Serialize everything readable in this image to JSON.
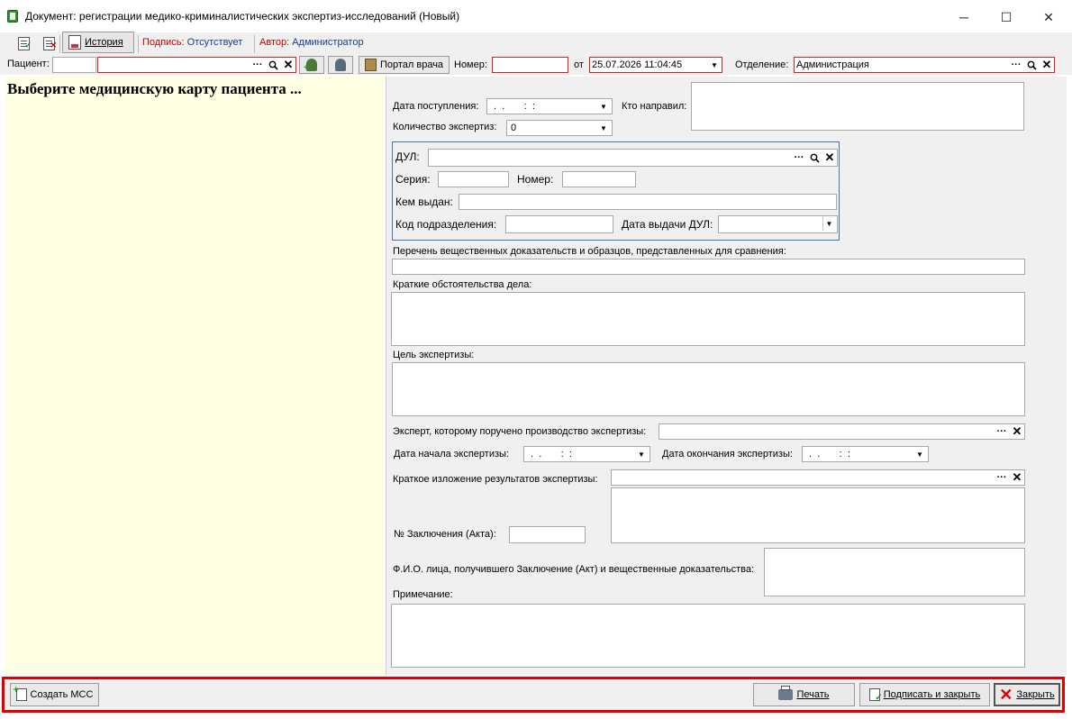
{
  "window": {
    "title": "Документ: регистрации медико-криминалистических экспертиз-исследований (Новый)",
    "minimize_glyph": "─",
    "maximize_glyph": "☐",
    "close_glyph": "✕"
  },
  "toolbar": {
    "history_label": "История",
    "signature_label": "Подпись:",
    "signature_value": "Отсутствует",
    "author_label": "Автор:",
    "author_value": "Администратор"
  },
  "patient_bar": {
    "patient_label": "Пациент:",
    "patient_code_value": "",
    "patient_name_value": "",
    "ellipsis": "···",
    "search_glyph": "🔍",
    "clear_glyph": "✕",
    "portal_label": "Портал врача",
    "number_label": "Номер:",
    "number_value": "",
    "date_from_label": "от",
    "date_value": "25.07.2026 11:04:45",
    "department_label": "Отделение:",
    "department_value": "Администрация"
  },
  "left_panel": {
    "hint": "Выберите медицинскую карту пациента ..."
  },
  "form": {
    "admission_date_label": "Дата поступления:",
    "admission_date_value": " .  .       :  :",
    "referred_by_label": "Кто направил:",
    "exam_count_label": "Количество экспертиз:",
    "exam_count_value": "0",
    "dul_label": "ДУЛ:",
    "series_label": "Серия:",
    "number_label": "Номер:",
    "issued_by_label": "Кем выдан:",
    "division_code_label": "Код подразделения:",
    "dul_issue_date_label": "Дата выдачи ДУЛ:",
    "evidence_list_label": "Перечень вещественных доказательств и образцов, представленных для сравнения:",
    "circumstances_label": "Краткие обстоятельства дела:",
    "purpose_label": "Цель экспертизы:",
    "expert_label": "Эксперт, которому поручено производство экспертизы:",
    "start_date_label": "Дата начала экспертизы:",
    "start_date_value": " .  .       :  :",
    "end_date_label": "Дата окончания экспертизы:",
    "end_date_value": " .  .       :  :",
    "results_label": "Краткое изложение результатов экспертизы:",
    "conclusion_number_label": "№ Заключения (Акта):",
    "recipient_label": "Ф.И.О. лица, получившего Заключение (Акт) и вещественные доказательства:",
    "note_label": "Примечание:"
  },
  "footer": {
    "create_mss_label": "Создать МСС",
    "print_label": "Печать",
    "sign_close_label": "Подписать и закрыть",
    "close_label": "Закрыть"
  }
}
